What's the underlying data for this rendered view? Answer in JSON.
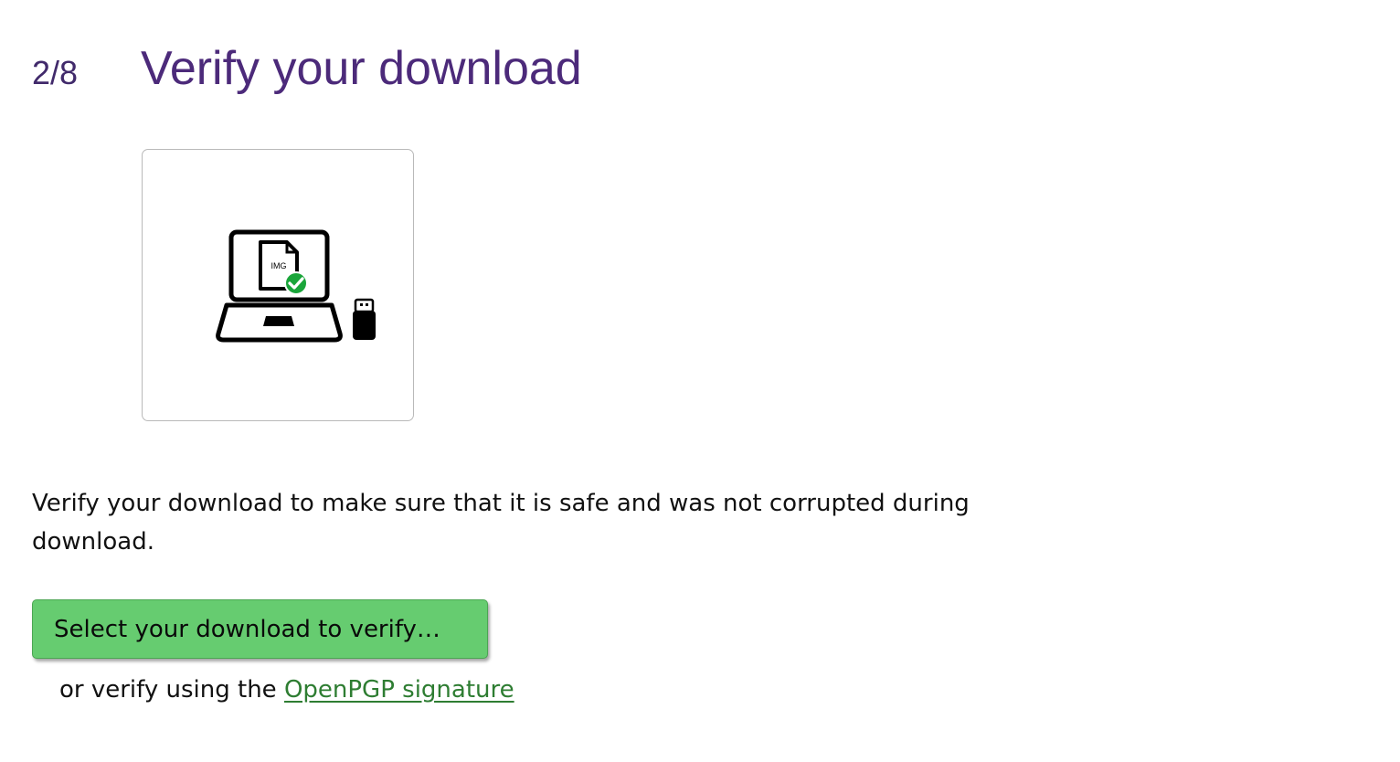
{
  "step": {
    "number": "2/8",
    "title": "Verify your download"
  },
  "illustration": {
    "file_label": "IMG",
    "icons": [
      "laptop-icon",
      "image-file-icon",
      "checkmark-badge-icon",
      "usb-stick-icon"
    ],
    "check_color": "#1AA53A"
  },
  "description": "Verify your download to make sure that it is safe and was not corrupted during download.",
  "actions": {
    "verify_button_label": "Select your download to verify…",
    "alt_prefix": "or verify using the ",
    "alt_link_label": "OpenPGP signature"
  },
  "colors": {
    "title": "#4C2A7A",
    "button": "#66CC70",
    "link": "#2E7D32"
  }
}
